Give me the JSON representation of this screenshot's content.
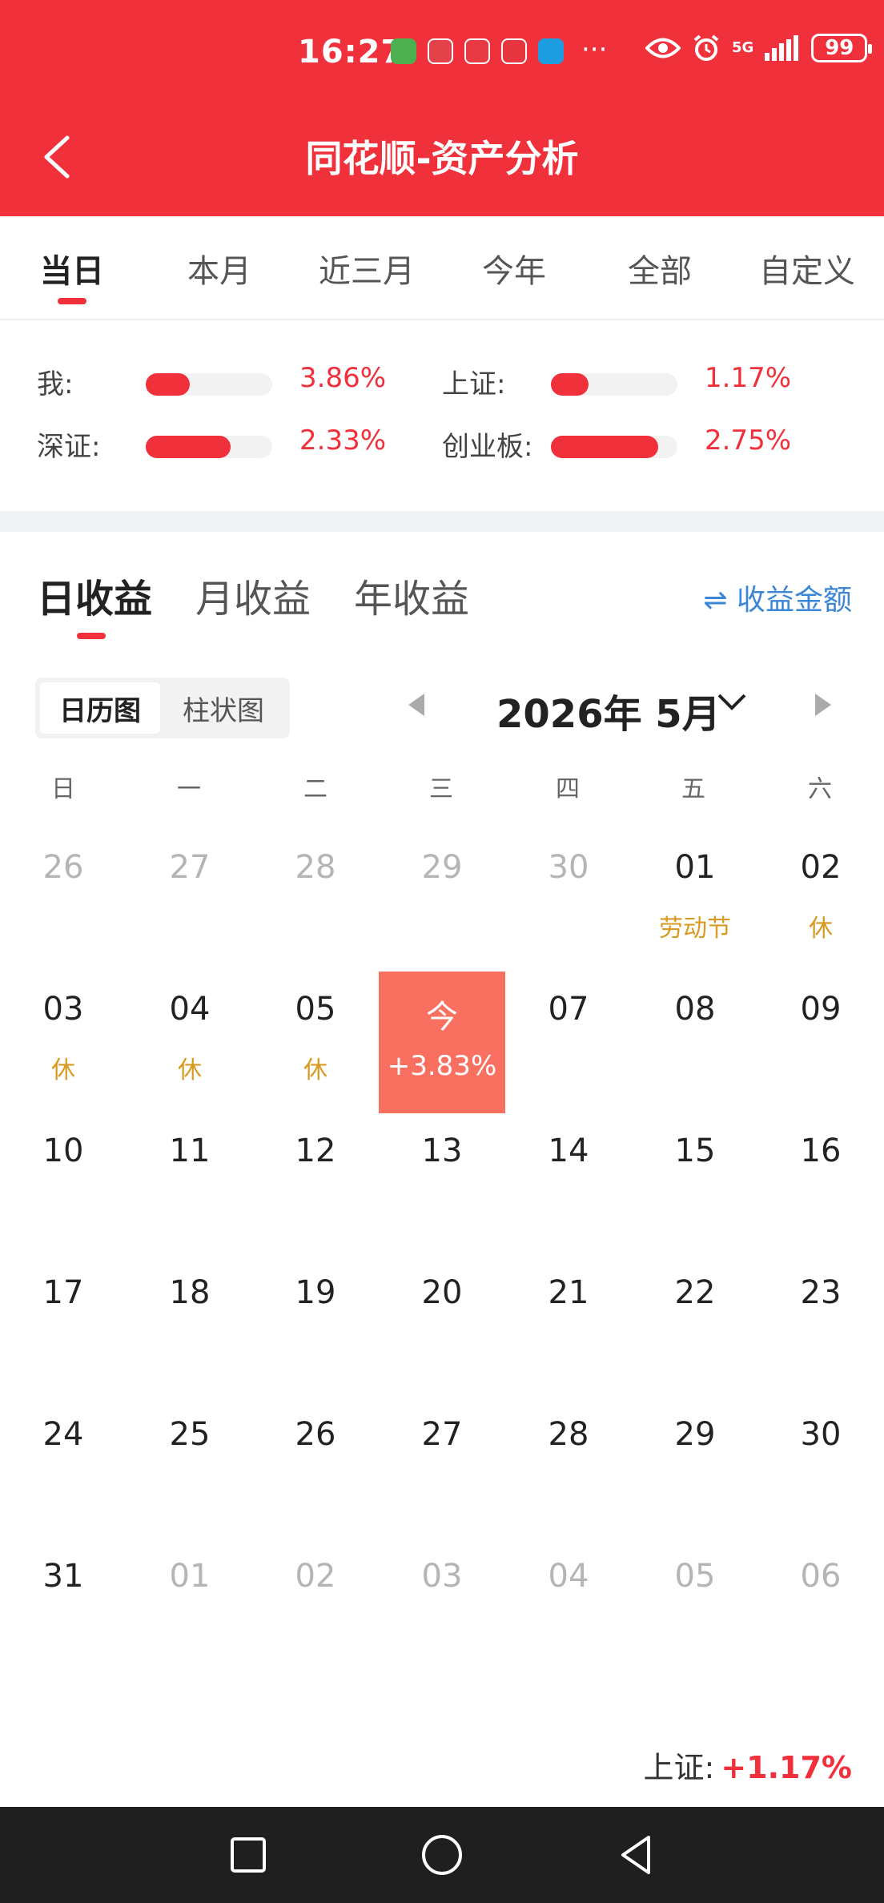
{
  "status_bar": {
    "time": "16:27",
    "more": "···",
    "network": "5G",
    "battery": "99",
    "apps": [
      {
        "icon": "app-green-icon",
        "color": "#4caf50"
      },
      {
        "icon": "app-red-icon",
        "color": "#e2424a"
      },
      {
        "icon": "app-book-icon",
        "color": "#e83a44"
      },
      {
        "icon": "app-zhang-icon",
        "color": "#e5363f"
      },
      {
        "icon": "app-blue-icon",
        "color": "#1e9de2"
      }
    ]
  },
  "header": {
    "title": "同花顺-资产分析",
    "back_icon": "chevron-left-icon"
  },
  "period_tabs": [
    {
      "label": "当日",
      "active": true
    },
    {
      "label": "本月",
      "active": false
    },
    {
      "label": "近三月",
      "active": false
    },
    {
      "label": "今年",
      "active": false
    },
    {
      "label": "全部",
      "active": false
    },
    {
      "label": "自定义",
      "active": false
    }
  ],
  "comparison": [
    {
      "label": "我:",
      "value": "3.86%",
      "fill": 0.35
    },
    {
      "label": "上证:",
      "value": "1.17%",
      "fill": 0.3
    },
    {
      "label": "深证:",
      "value": "2.33%",
      "fill": 0.67
    },
    {
      "label": "创业板:",
      "value": "2.75%",
      "fill": 0.85
    }
  ],
  "profit_tabs": [
    {
      "label": "日收益",
      "active": true
    },
    {
      "label": "月收益",
      "active": false
    },
    {
      "label": "年收益",
      "active": false
    }
  ],
  "amount_link": {
    "icon": "swap-arrows-icon",
    "label": "⇌ 收益金额"
  },
  "view_toggle": [
    {
      "label": "日历图",
      "active": true
    },
    {
      "label": "柱状图",
      "active": false
    }
  ],
  "month_picker": {
    "label": "2026年 5月"
  },
  "weekdays": [
    "日",
    "一",
    "二",
    "三",
    "四",
    "五",
    "六"
  ],
  "calendar": [
    [
      {
        "d": "26",
        "dim": true
      },
      {
        "d": "27",
        "dim": true
      },
      {
        "d": "28",
        "dim": true
      },
      {
        "d": "29",
        "dim": true
      },
      {
        "d": "30",
        "dim": true
      },
      {
        "d": "01",
        "tag": "劳动节"
      },
      {
        "d": "02",
        "tag": "休"
      }
    ],
    [
      {
        "d": "03",
        "tag": "休"
      },
      {
        "d": "04",
        "tag": "休"
      },
      {
        "d": "05",
        "tag": "休"
      },
      {
        "d": "今",
        "tag": "+3.83%",
        "today": true
      },
      {
        "d": "07"
      },
      {
        "d": "08"
      },
      {
        "d": "09"
      }
    ],
    [
      {
        "d": "10"
      },
      {
        "d": "11"
      },
      {
        "d": "12"
      },
      {
        "d": "13"
      },
      {
        "d": "14"
      },
      {
        "d": "15"
      },
      {
        "d": "16"
      }
    ],
    [
      {
        "d": "17"
      },
      {
        "d": "18"
      },
      {
        "d": "19"
      },
      {
        "d": "20"
      },
      {
        "d": "21"
      },
      {
        "d": "22"
      },
      {
        "d": "23"
      }
    ],
    [
      {
        "d": "24"
      },
      {
        "d": "25"
      },
      {
        "d": "26"
      },
      {
        "d": "27"
      },
      {
        "d": "28"
      },
      {
        "d": "29"
      },
      {
        "d": "30"
      }
    ],
    [
      {
        "d": "31"
      },
      {
        "d": "01",
        "dim": true
      },
      {
        "d": "02",
        "dim": true
      },
      {
        "d": "03",
        "dim": true
      },
      {
        "d": "04",
        "dim": true
      },
      {
        "d": "05",
        "dim": true
      },
      {
        "d": "06",
        "dim": true
      }
    ]
  ],
  "footer_index": {
    "label": "上证:",
    "value": "+1.17%"
  },
  "nav_bar": [
    {
      "icon": "recent-apps-square-icon"
    },
    {
      "icon": "home-circle-icon"
    },
    {
      "icon": "back-triangle-icon"
    }
  ],
  "colors": {
    "brand_red": "#f0313c",
    "today_bg": "#fa7060",
    "holiday": "#d99a22",
    "link_blue": "#3b86d6"
  }
}
